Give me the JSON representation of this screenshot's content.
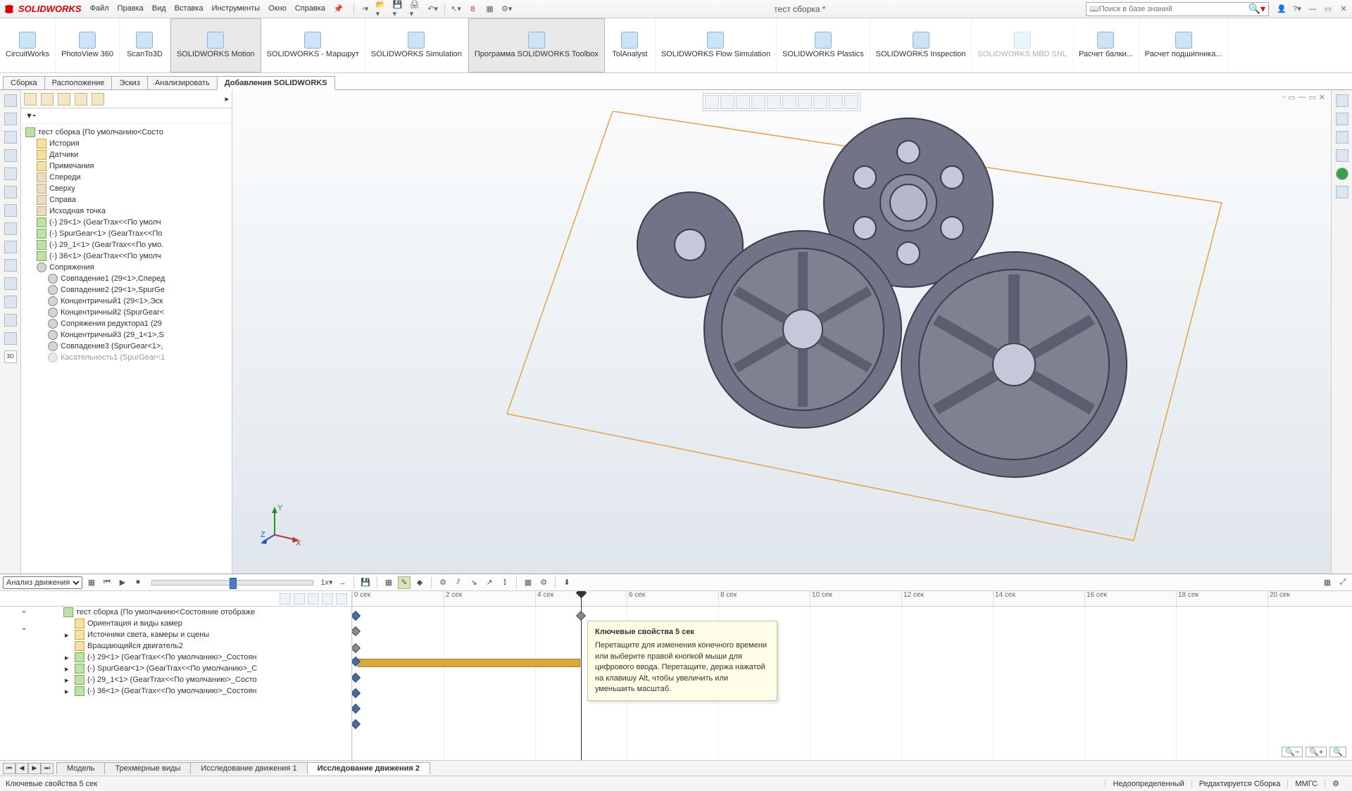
{
  "brand": "SOLIDWORKS",
  "menu": [
    "Файл",
    "Правка",
    "Вид",
    "Вставка",
    "Инструменты",
    "Окно",
    "Справка"
  ],
  "doc_title": "тест сборка *",
  "search_placeholder": "Поиск в базе знаний",
  "ribbon": [
    {
      "label": "CircuitWorks"
    },
    {
      "label": "PhotoView 360"
    },
    {
      "label": "ScanTo3D"
    },
    {
      "label": "SOLIDWORKS Motion",
      "sel": true
    },
    {
      "label": "SOLIDWORKS - Маршрут"
    },
    {
      "label": "SOLIDWORKS Simulation"
    },
    {
      "label": "Программа SOLIDWORKS Toolbox",
      "sel": true
    },
    {
      "label": "TolAnalyst"
    },
    {
      "label": "SOLIDWORKS Flow Simulation"
    },
    {
      "label": "SOLIDWORKS Plastics"
    },
    {
      "label": "SOLIDWORKS Inspection"
    },
    {
      "label": "SOLIDWORKS MBD SNL",
      "dim": true
    },
    {
      "label": "Расчет балки...",
      "narrow": true
    },
    {
      "label": "Расчет подшипника...",
      "narrow": true
    }
  ],
  "tabs": [
    "Сборка",
    "Расположение",
    "Эскиз",
    "Анализировать",
    "Добавления SOLIDWORKS"
  ],
  "tabs_active": 4,
  "tree_root": "тест сборка  (По умолчанию<Состо",
  "tree": [
    {
      "t": "История",
      "ico": "doc",
      "i": 1
    },
    {
      "t": "Датчики",
      "ico": "doc",
      "i": 1
    },
    {
      "t": "Примечания",
      "ico": "doc",
      "i": 1
    },
    {
      "t": "Спереди",
      "ico": "plane",
      "i": 1
    },
    {
      "t": "Сверху",
      "ico": "plane",
      "i": 1
    },
    {
      "t": "Справа",
      "ico": "plane",
      "i": 1
    },
    {
      "t": "Исходная точка",
      "ico": "plane",
      "i": 1
    },
    {
      "t": "(-) 29<1> (GearTrax<<По умолч",
      "ico": "comp",
      "i": 1
    },
    {
      "t": "(-) SpurGear<1> (GearTrax<<По",
      "ico": "comp",
      "i": 1
    },
    {
      "t": "(-) 29_1<1> (GearTrax<<По умо.",
      "ico": "comp",
      "i": 1
    },
    {
      "t": "(-) 36<1> (GearTrax<<По умолч",
      "ico": "comp",
      "i": 1
    },
    {
      "t": "Сопряжения",
      "ico": "mate",
      "i": 1
    },
    {
      "t": "Совпадение1 (29<1>,Сперед",
      "ico": "mate",
      "i": 2
    },
    {
      "t": "Совпадение2 (29<1>,SpurGe",
      "ico": "mate",
      "i": 2
    },
    {
      "t": "Концентричный1 (29<1>,Эск",
      "ico": "mate",
      "i": 2
    },
    {
      "t": "Концентричный2 (SpurGear<",
      "ico": "mate",
      "i": 2
    },
    {
      "t": "Сопряжения редуктора1 (29",
      "ico": "mate",
      "i": 2
    },
    {
      "t": "Концентричный3 (29_1<1>,S",
      "ico": "mate",
      "i": 2
    },
    {
      "t": "Совпадение3 (SpurGear<1>,",
      "ico": "mate",
      "i": 2
    },
    {
      "t": "Касательность1 (SpurGear<1",
      "ico": "mate",
      "i": 2,
      "dim": true
    }
  ],
  "motion_study_type": "Анализ движения",
  "motion_tree": [
    {
      "t": "тест сборка  (По умолчанию<Состояние отображе",
      "ico": "comp",
      "i": 0
    },
    {
      "t": "Ориентация и виды камер",
      "ico": "doc",
      "i": 1
    },
    {
      "t": "Источники света, камеры и сцены",
      "ico": "doc",
      "i": 1,
      "exp": true
    },
    {
      "t": "Вращающийся двигатель2",
      "ico": "doc",
      "i": 1
    },
    {
      "t": "(-) 29<1> (GearTrax<<По умолчанию>_Состоян",
      "ico": "comp",
      "i": 1,
      "exp": true
    },
    {
      "t": "(-) SpurGear<1> (GearTrax<<По умолчанию>_С",
      "ico": "comp",
      "i": 1,
      "exp": true
    },
    {
      "t": "(-) 29_1<1> (GearTrax<<По умолчанию>_Состо",
      "ico": "comp",
      "i": 1,
      "exp": true
    },
    {
      "t": "(-) 36<1> (GearTrax<<По умолчанию>_Состоян",
      "ico": "comp",
      "i": 1,
      "exp": true
    }
  ],
  "time_ticks": [
    "0 сек",
    "2 сек",
    "4 сек",
    "6 сек",
    "8 сек",
    "10 сек",
    "12 сек",
    "14 сек",
    "16 сек",
    "18 сек",
    "20 сек"
  ],
  "tooltip": {
    "title": "Ключевые свойства 5 сек",
    "body": "Перетащите для изменения конечного времени или выберите правой кнопкой мыши для цифрового ввода. Перетащите, держа нажатой на клавишу Alt, чтобы увеличить или уменьшить масштаб."
  },
  "doc_tabs": [
    "Модель",
    "Трехмерные виды",
    "Исследование движения 1",
    "Исследование движения 2"
  ],
  "doc_tabs_active": 3,
  "status": {
    "left": "Ключевые свойства 5 сек",
    "under": "Недоопределенный",
    "edit": "Редактируется Сборка",
    "units": "ММГС"
  }
}
